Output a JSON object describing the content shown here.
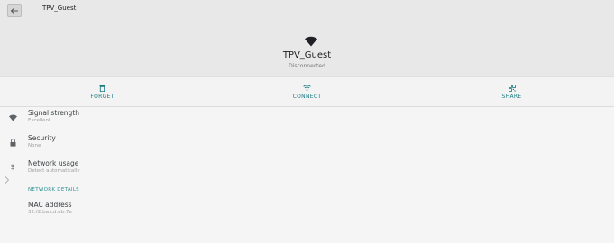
{
  "app_bar": {
    "title": "TPV_Guest"
  },
  "header": {
    "network_name": "TPV_Guest",
    "status": "Disconnected"
  },
  "actions": [
    {
      "label": "FORGET",
      "icon": "trash-icon"
    },
    {
      "label": "CONNECT",
      "icon": "wifi-icon"
    },
    {
      "label": "SHARE",
      "icon": "qr-code-icon"
    }
  ],
  "details": [
    {
      "title": "Signal strength",
      "value": "Excellent",
      "icon": "wifi-signal-icon"
    },
    {
      "title": "Security",
      "value": "None",
      "icon": "lock-icon"
    },
    {
      "title": "Network usage",
      "value": "Detect automatically",
      "icon": "dollar-icon"
    }
  ],
  "network_details": {
    "section_label": "NETWORK DETAILS",
    "mac_title": "MAC address",
    "mac_value": "32:f2:ba:cd:eb:7e"
  },
  "colors": {
    "accent": "#1a7a80",
    "header_bg": "#e8e8e8",
    "page_bg": "#f5f5f5"
  }
}
